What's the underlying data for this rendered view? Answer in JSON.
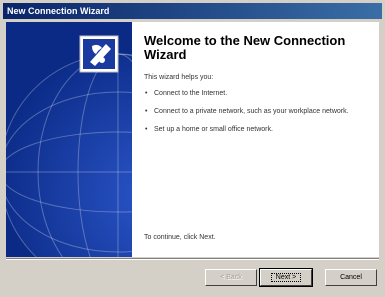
{
  "window": {
    "title": "New Connection Wizard"
  },
  "heading": "Welcome to the New Connection Wizard",
  "intro": "This wizard helps you:",
  "bullets": [
    "Connect to the Internet.",
    "Connect to a private network, such as your workplace network.",
    "Set up a home or small office network."
  ],
  "footer_text": "To continue, click Next.",
  "buttons": {
    "back": "< Back",
    "next": "Next >",
    "cancel": "Cancel"
  },
  "colors": {
    "titlebar": "#0a246a",
    "side_panel": "#0b2a86",
    "dialog_bg": "#d4d0c8"
  },
  "icons": {
    "wizard": "phone-globe-wizard-icon"
  }
}
